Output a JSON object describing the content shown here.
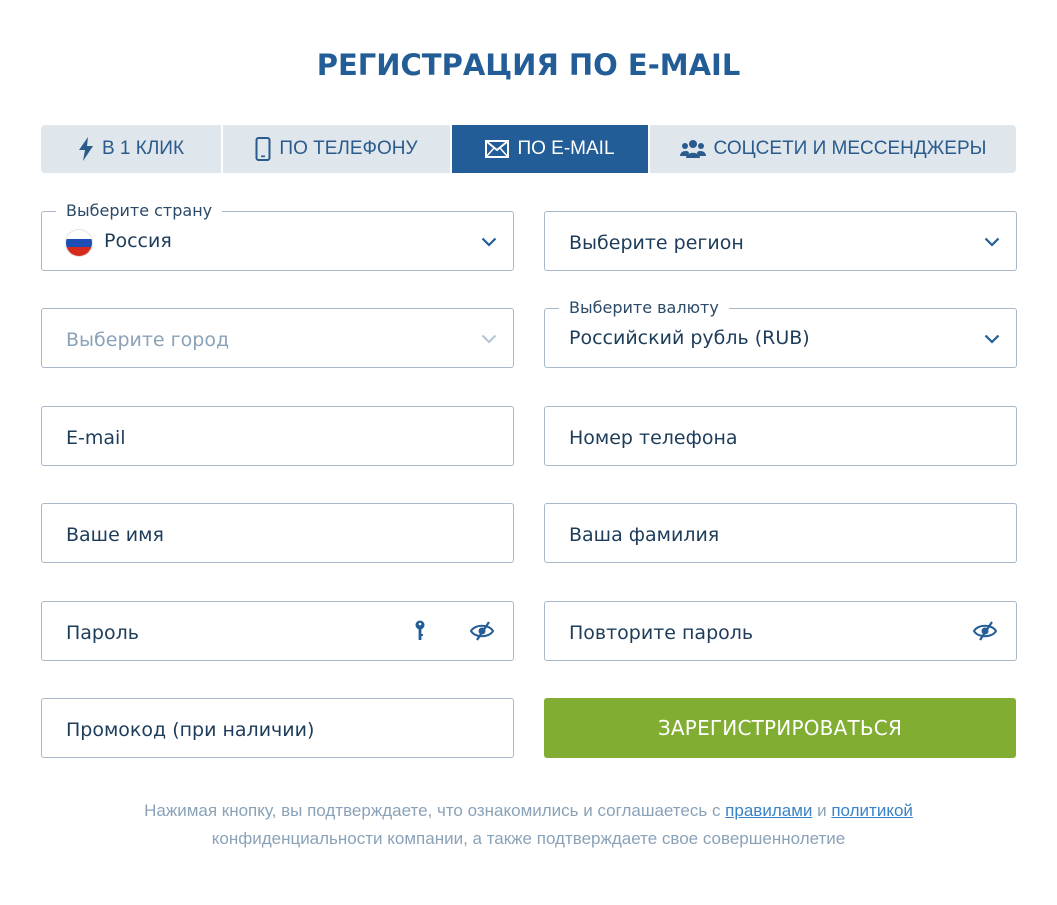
{
  "title": "РЕГИСТРАЦИЯ ПО E-MAIL",
  "tabs": [
    {
      "label": "В 1 КЛИК",
      "icon": "lightning-icon",
      "active": false
    },
    {
      "label": "ПО ТЕЛЕФОНУ",
      "icon": "phone-icon",
      "active": false
    },
    {
      "label": "ПО E-MAIL",
      "icon": "envelope-icon",
      "active": true
    },
    {
      "label": "СОЦСЕТИ И МЕССЕНДЖЕРЫ",
      "icon": "users-icon",
      "active": false
    }
  ],
  "form": {
    "country": {
      "label": "Выберите страну",
      "value": "Россия",
      "flag": "russia-flag-icon"
    },
    "region": {
      "placeholder": "Выберите регион"
    },
    "city": {
      "placeholder": "Выберите город"
    },
    "currency": {
      "label": "Выберите валюту",
      "value": "Российский рубль (RUB)"
    },
    "email": {
      "placeholder": "E-mail"
    },
    "phone": {
      "placeholder": "Номер телефона"
    },
    "first_name": {
      "placeholder": "Ваше имя"
    },
    "last_name": {
      "placeholder": "Ваша фамилия"
    },
    "password": {
      "placeholder": "Пароль"
    },
    "password_repeat": {
      "placeholder": "Повторите пароль"
    },
    "promo": {
      "placeholder": "Промокод (при наличии)"
    },
    "submit_label": "ЗАРЕГИСТРИРОВАТЬСЯ"
  },
  "disclaimer": {
    "text_before": "Нажимая кнопку, вы подтверждаете, что ознакомились и соглашаетесь с ",
    "link_rules": "правилами",
    "text_and": " и ",
    "link_policy": "политикой",
    "text_after": "конфиденциальности компании, а также подтверждаете свое совершеннолетие"
  },
  "colors": {
    "accent": "#235d97",
    "tab_inactive": "#dfe6ec",
    "submit": "#80ad32",
    "border": "#a7b9ca",
    "link": "#3a83c6"
  }
}
